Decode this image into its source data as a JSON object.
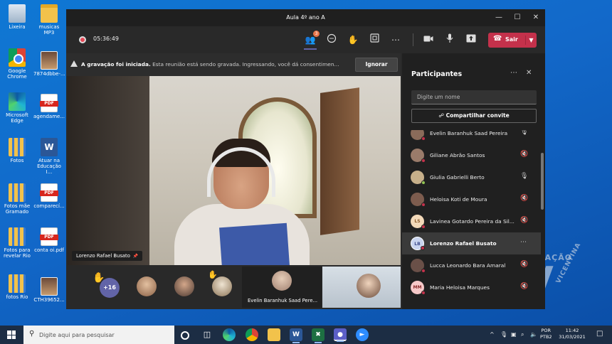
{
  "desktop": {
    "icons": [
      {
        "label": "Lixeira"
      },
      {
        "label": "musicas MP3"
      },
      {
        "label": "Google Chrome"
      },
      {
        "label": "7874dbbe-..."
      },
      {
        "label": "Microsoft Edge"
      },
      {
        "label": "agendame..."
      },
      {
        "label": "Fotos"
      },
      {
        "label": "Atuar na Educação I..."
      },
      {
        "label": "Fotos mãe Gramado"
      },
      {
        "label": "comparecí..."
      },
      {
        "label": "Fotos para revelar Rio"
      },
      {
        "label": "conta oi.pdf"
      },
      {
        "label": "fotos Rio"
      },
      {
        "label": "CTH39652..."
      }
    ],
    "pdf_badge": "PDF",
    "word_badge": "W"
  },
  "teams": {
    "title": "Aula 4º ano A",
    "timer": "05:36:49",
    "participants_badge": "3",
    "leave_label": "Sair",
    "banner": {
      "bold": "A gravação foi iniciada.",
      "text": "Esta reunião está sendo gravada. Ingressando, você dá consentimen...",
      "dismiss": "Ignorar"
    },
    "speaker_name": "Lorenzo Rafael Busato",
    "gallery": {
      "more_count": "+16",
      "tile_name": "Evelin Baranhuk Saad Pere..."
    },
    "panel": {
      "title": "Participantes",
      "search_placeholder": "Digite um nome",
      "share_label": "Compartilhar convite",
      "participants": [
        {
          "name": "Evelin Baranhuk Saad Pereira",
          "initials": "",
          "color": "#8a6b5a",
          "status": "#c4314b",
          "mic": "on"
        },
        {
          "name": "Giliane Abrão Santos",
          "initials": "",
          "color": "#9a7b6a",
          "status": "#c4314b",
          "mic": "off"
        },
        {
          "name": "Giulia Gabrielli Berto",
          "initials": "",
          "color": "#c7b08a",
          "status": "#92c353",
          "mic": "on"
        },
        {
          "name": "Heloisa Koti de Moura",
          "initials": "",
          "color": "#7d5c4e",
          "status": "#c4314b",
          "mic": "off"
        },
        {
          "name": "Lavinea Gotardo Pereira da Sil...",
          "initials": "LS",
          "color": "#f3d9b9",
          "status": "#c4314b",
          "mic": "off"
        },
        {
          "name": "Lorenzo Rafael Busato",
          "initials": "LB",
          "color": "#c9d4ef",
          "status": "#c4314b",
          "mic": "more"
        },
        {
          "name": "Lucca Leonardo Bara Amaral",
          "initials": "",
          "color": "#6a5048",
          "status": "#c4314b",
          "mic": "off"
        },
        {
          "name": "Maria Heloisa Marques",
          "initials": "MM",
          "color": "#f7c9c9",
          "status": "#c4314b",
          "mic": "off"
        }
      ]
    }
  },
  "watermark": {
    "top": "EDUCAÇÃO",
    "side": "VICENTINA",
    "letter": "V"
  },
  "taskbar": {
    "search_placeholder": "Digite aqui para pesquisar",
    "lang_top": "POR",
    "lang_bottom": "PTB2",
    "time": "11:42",
    "date": "31/03/2021"
  }
}
